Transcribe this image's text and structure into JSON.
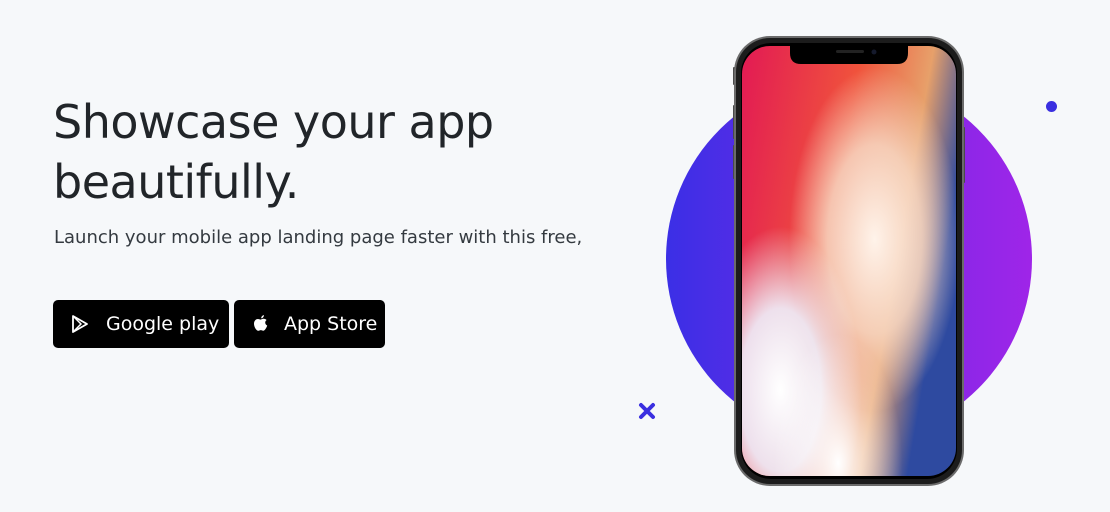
{
  "hero": {
    "headline_line1": "Showcase your app",
    "headline_line2": "beautifully.",
    "subtext": "Launch your mobile app landing page faster with this free,"
  },
  "buttons": {
    "google_play_label": "Google play",
    "app_store_label": "App Store"
  },
  "icons": {
    "google_play": "google-play-icon",
    "apple": "apple-icon"
  },
  "colors": {
    "background": "#f6f8fa",
    "heading": "#212529",
    "button_bg": "#000000",
    "circle_start": "#3b2fe6",
    "circle_end": "#9f25e8",
    "accent": "#3a2fe0"
  }
}
